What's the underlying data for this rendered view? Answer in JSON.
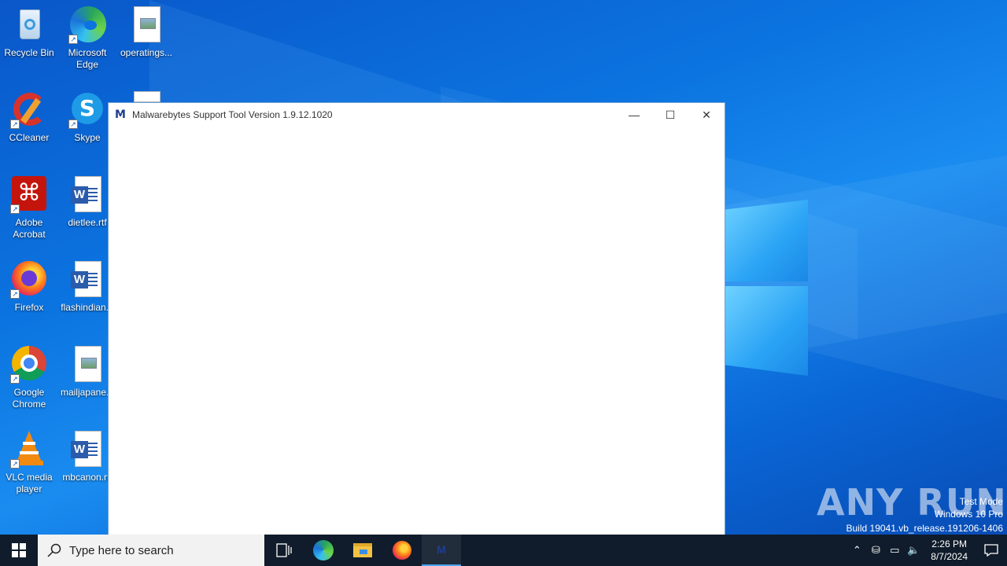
{
  "desktop": {
    "icons": [
      {
        "label": "Recycle Bin"
      },
      {
        "label": "Microsoft Edge"
      },
      {
        "label": "operatings..."
      },
      {
        "label": "CCleaner"
      },
      {
        "label": "Skype"
      },
      {
        "label": "Adobe Acrobat"
      },
      {
        "label": "dietlee.rtf"
      },
      {
        "label": "Firefox"
      },
      {
        "label": "flashindian..."
      },
      {
        "label": "Google Chrome"
      },
      {
        "label": "mailjapane..."
      },
      {
        "label": "VLC media player"
      },
      {
        "label": "mbcanon.rtf"
      }
    ]
  },
  "window": {
    "title": "Malwarebytes Support Tool Version 1.9.12.1020",
    "app_icon": "M",
    "minimize": "—",
    "maximize": "☐",
    "close": "✕"
  },
  "taskbar": {
    "search_placeholder": "Type here to search",
    "clock_time": "2:26 PM",
    "clock_date": "8/7/2024"
  },
  "watermark": {
    "line1": "Test Mode",
    "line2": "Windows 10 Pro",
    "line3": "Build 19041.vb_release.191206-1406",
    "brand": "ANY RUN"
  },
  "colors": {
    "taskbar": "#101c2b",
    "accent": "#0b74e0"
  }
}
